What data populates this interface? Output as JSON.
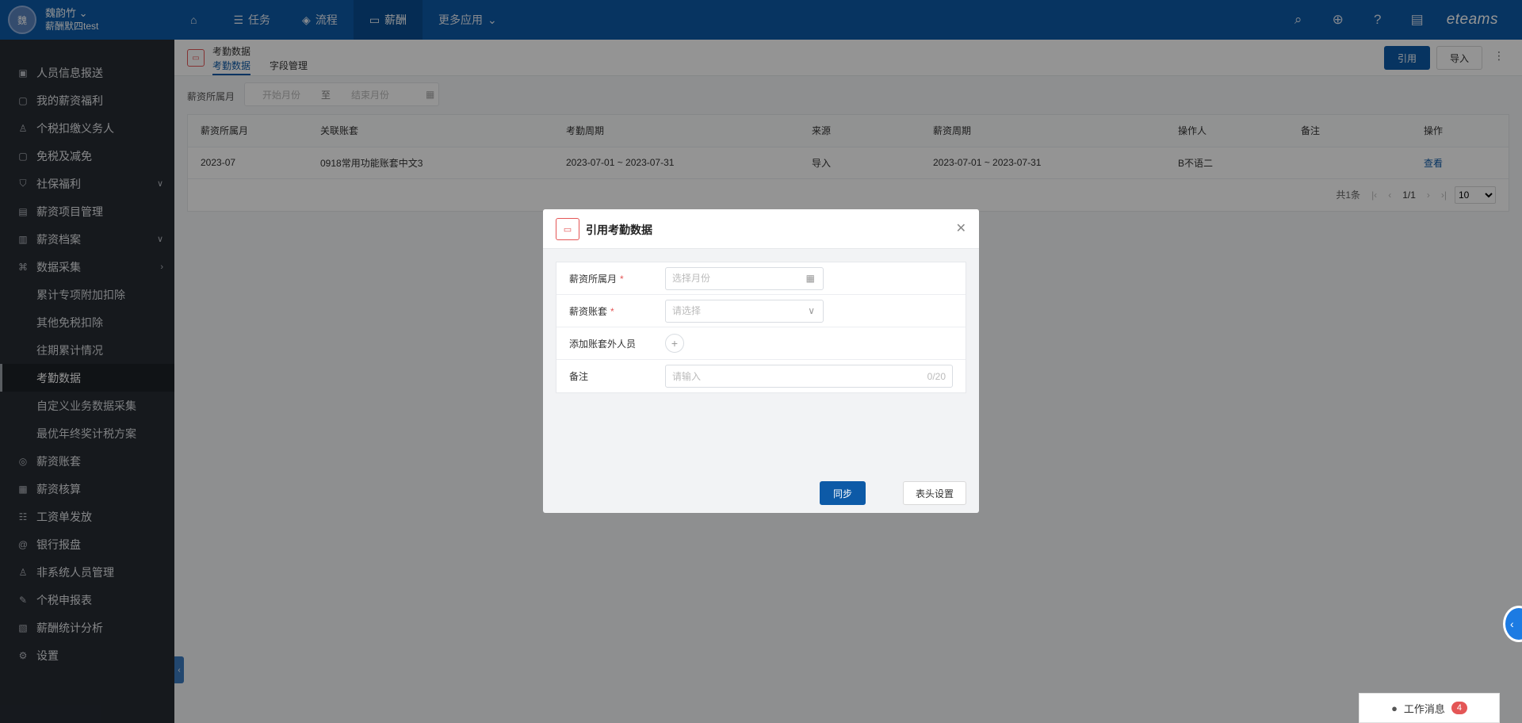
{
  "user": {
    "avatar_text": "魏",
    "name": "魏韵竹",
    "org": "薪酬默四test"
  },
  "nav": [
    {
      "label": "",
      "icon": "⌂",
      "icon_name": "home-icon"
    },
    {
      "label": "任务",
      "icon": "☰",
      "icon_name": "task-icon"
    },
    {
      "label": "流程",
      "icon": "◈",
      "icon_name": "flow-icon"
    },
    {
      "label": "薪酬",
      "icon": "▭",
      "icon_name": "salary-icon"
    },
    {
      "label": "更多应用",
      "icon": "⌄",
      "icon_name": "chevron-down-icon"
    }
  ],
  "brand": "eteams",
  "sidebar": {
    "items": [
      {
        "label": "人员信息报送"
      },
      {
        "label": "我的薪资福利"
      },
      {
        "label": "个税扣缴义务人"
      },
      {
        "label": "免税及减免"
      },
      {
        "label": "社保福利"
      },
      {
        "label": "薪资项目管理"
      },
      {
        "label": "薪资档案"
      },
      {
        "label": "数据采集"
      },
      {
        "label": "薪资账套"
      },
      {
        "label": "薪资核算"
      },
      {
        "label": "工资单发放"
      },
      {
        "label": "银行报盘"
      },
      {
        "label": "非系统人员管理"
      },
      {
        "label": "个税申报表"
      },
      {
        "label": "薪酬统计分析"
      },
      {
        "label": "设置"
      }
    ],
    "sub_items": [
      {
        "label": "累计专项附加扣除"
      },
      {
        "label": "其他免税扣除"
      },
      {
        "label": "往期累计情况"
      },
      {
        "label": "考勤数据"
      },
      {
        "label": "自定义业务数据采集"
      },
      {
        "label": "最优年终奖计税方案"
      }
    ]
  },
  "page": {
    "title": "考勤数据",
    "tabs": [
      {
        "label": "考勤数据"
      },
      {
        "label": "字段管理"
      }
    ],
    "btn_quote": "引用",
    "btn_import": "导入",
    "filter_label": "薪资所属月",
    "range_start": "开始月份",
    "range_sep": "至",
    "range_end": "结束月份"
  },
  "table": {
    "headers": [
      "薪资所属月",
      "关联账套",
      "考勤周期",
      "来源",
      "薪资周期",
      "操作人",
      "备注",
      "操作"
    ],
    "rows": [
      [
        "2023-07",
        "0918常用功能账套中文3",
        "2023-07-01 ~ 2023-07-31",
        "导入",
        "2023-07-01 ~ 2023-07-31",
        "B不语二",
        "",
        "查看"
      ]
    ],
    "total": "共1条",
    "page": "1/1",
    "page_size": "10"
  },
  "modal": {
    "title": "引用考勤数据",
    "fields": {
      "month_label": "薪资所属月",
      "month_placeholder": "选择月份",
      "account_label": "薪资账套",
      "account_placeholder": "请选择",
      "extra_label": "添加账套外人员",
      "remark_label": "备注",
      "remark_placeholder": "请输入",
      "remark_counter": "0/20"
    },
    "btn_sync": "同步",
    "btn_header": "表头设置"
  },
  "message": {
    "label": "工作消息",
    "count": "4"
  }
}
